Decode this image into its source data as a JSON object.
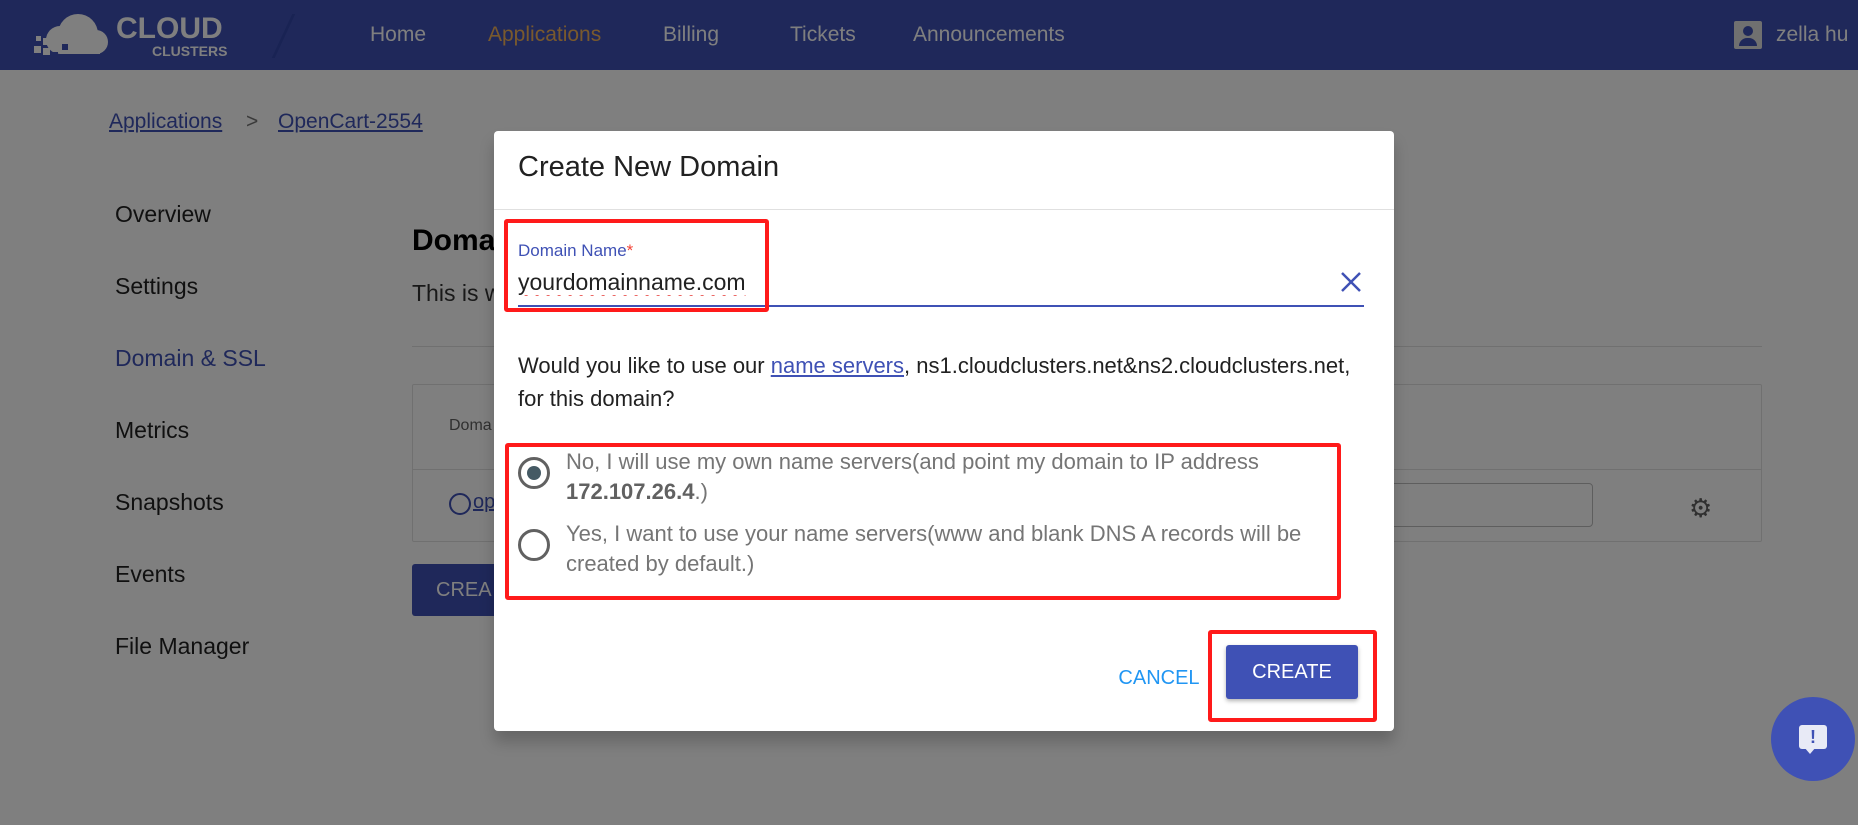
{
  "header": {
    "logo_text_1": "CLOUD",
    "logo_text_2": "CLUSTERS",
    "nav": [
      "Home",
      "Applications",
      "Billing",
      "Tickets",
      "Announcements"
    ],
    "active_nav": "Applications",
    "user_name": "zella hu",
    "accent_color": "#3f51b5",
    "active_color": "#f2b35a"
  },
  "breadcrumb": {
    "root": "Applications",
    "separator": ">",
    "current": "OpenCart-2554"
  },
  "sidebar": {
    "items": [
      "Overview",
      "Settings",
      "Domain & SSL",
      "Metrics",
      "Snapshots",
      "Events",
      "File Manager"
    ],
    "active": "Domain & SSL"
  },
  "main": {
    "title": "Doma",
    "desc": "This is w",
    "table_header": "Doma",
    "row_link": "op",
    "create_button": "CREA"
  },
  "dialog": {
    "title": "Create New Domain",
    "field_label": "Domain Name",
    "required_mark": "*",
    "field_value": "yourdomainname.com",
    "question_prefix": "Would you like to use our ",
    "question_link": "name servers",
    "question_suffix": ", ns1.cloudclusters.net&ns2.cloudclusters.net, for this domain?",
    "option_no_prefix": "No, I will use my own name servers(and point my domain to IP address ",
    "option_no_ip": "172.107.26.4",
    "option_no_suffix": ".)",
    "option_yes": "Yes, I want to use your name servers(www and blank DNS A records will be created by default.)",
    "selected_option": "no",
    "cancel_label": "CANCEL",
    "create_label": "CREATE"
  },
  "chat": {
    "icon": "chat-alert-icon",
    "label": "!"
  }
}
